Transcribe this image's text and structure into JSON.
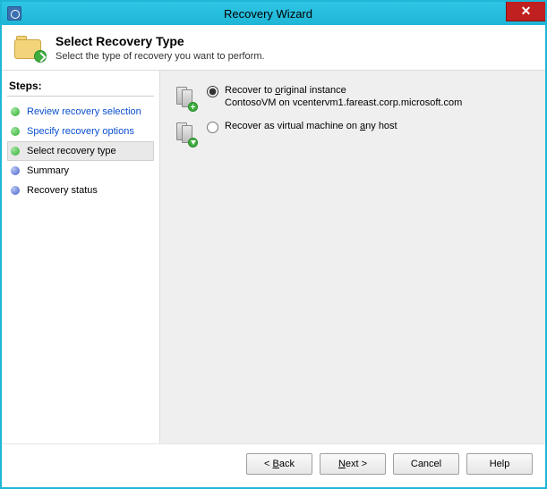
{
  "window": {
    "title": "Recovery Wizard"
  },
  "header": {
    "title": "Select Recovery Type",
    "subtitle": "Select the type of recovery you want to perform."
  },
  "steps": {
    "heading": "Steps:",
    "items": [
      {
        "label": "Review recovery selection",
        "state": "done",
        "link": true
      },
      {
        "label": "Specify recovery options",
        "state": "done",
        "link": true
      },
      {
        "label": "Select recovery type",
        "state": "current",
        "link": false
      },
      {
        "label": "Summary",
        "state": "pending",
        "link": false
      },
      {
        "label": "Recovery status",
        "state": "pending",
        "link": false
      }
    ]
  },
  "options": {
    "recover_original": {
      "label_pre": "Recover to ",
      "hotkey": "o",
      "label_post": "riginal instance",
      "sub": "ContosoVM on vcentervm1.fareast.corp.microsoft.com",
      "selected": true
    },
    "recover_any": {
      "label_pre": "Recover as virtual machine on ",
      "hotkey": "a",
      "label_post_1": "ny host",
      "selected": false
    }
  },
  "buttons": {
    "back": {
      "pre": "< ",
      "hot": "B",
      "post": "ack"
    },
    "next": {
      "hot": "N",
      "post": "ext >"
    },
    "cancel": {
      "label": "Cancel"
    },
    "help": {
      "label": "Help"
    }
  }
}
